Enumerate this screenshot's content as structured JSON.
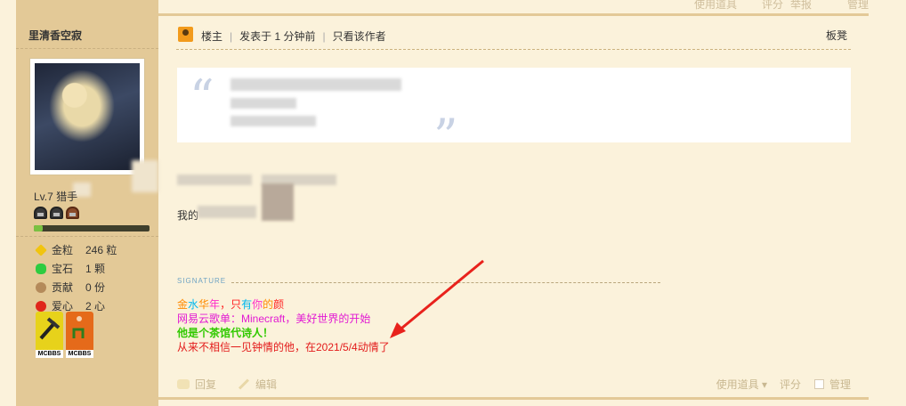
{
  "top_faint": {
    "share": "使用道具",
    "rate": "评分",
    "report": "举报",
    "manage": "管理"
  },
  "user": {
    "name": "里清香空寂",
    "level": "Lv.7 猎手",
    "exp_fraction": 0.08,
    "stats": [
      {
        "icon": "gold-nugget-icon",
        "label": "金粒",
        "value": "246 粒",
        "color": "#f1c40f"
      },
      {
        "icon": "gem-icon",
        "label": "宝石",
        "value": "1 颗",
        "color": "#2ecc40"
      },
      {
        "icon": "contribution-icon",
        "label": "贡献",
        "value": "0 份",
        "color": "#b48a5a"
      },
      {
        "icon": "heart-apple-icon",
        "label": "爱心",
        "value": "2 心",
        "color": "#e0261b"
      }
    ],
    "medals": [
      {
        "name": "pickaxe-medal-icon",
        "caption": "MCBBS"
      },
      {
        "name": "music-medal-icon",
        "caption": "MCBBS"
      }
    ]
  },
  "post": {
    "author_tag": "楼主",
    "posted": "发表于 1 分钟前",
    "only_author": "只看该作者",
    "floor": "板凳",
    "body_prefix": "我的"
  },
  "signature": {
    "label": "SIGNATURE",
    "line1_parts": [
      {
        "text": "金",
        "color": "#ff8a00"
      },
      {
        "text": "水",
        "color": "#00b7ee"
      },
      {
        "text": "华",
        "color": "#ff8a00"
      },
      {
        "text": "年",
        "color": "#ff2cc8"
      },
      {
        "text": "，只",
        "color": "#ff2424"
      },
      {
        "text": "有",
        "color": "#00b7ee"
      },
      {
        "text": "你",
        "color": "#ff2cc8"
      },
      {
        "text": "的",
        "color": "#ff8a00"
      },
      {
        "text": "颜",
        "color": "#ff2424"
      }
    ],
    "line2": "网易云歌单：Minecraft，美好世界的开始",
    "line3": "他是个茶馆代诗人！",
    "line4": "从来不相信一见钟情的他，在2021/5/4动情了",
    "colors": {
      "line2": "#e21ad3",
      "line3": "#31c900",
      "line4": "#e31b1b"
    }
  },
  "footer": {
    "reply": "回复",
    "edit": "编辑",
    "use_item": "使用道具",
    "rate": "评分",
    "manage": "管理"
  }
}
